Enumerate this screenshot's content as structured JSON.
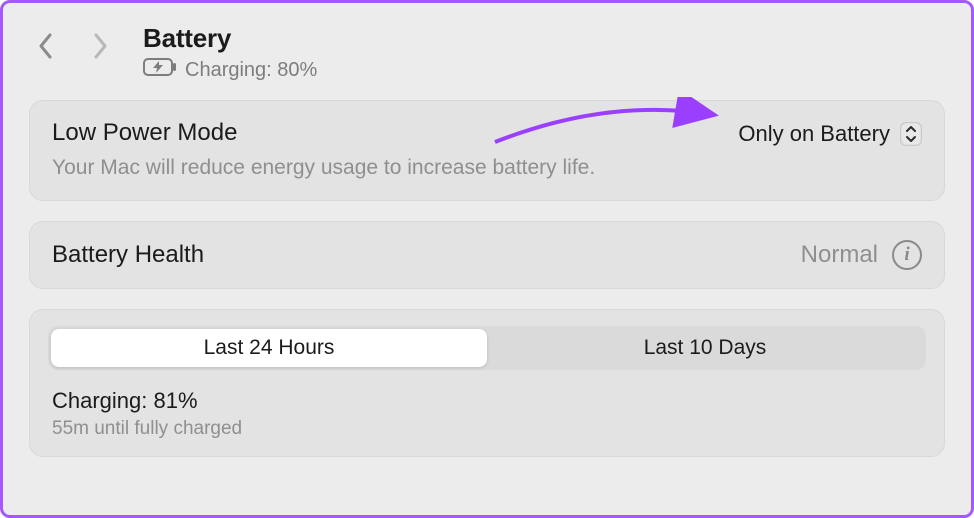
{
  "header": {
    "title": "Battery",
    "status": "Charging: 80%"
  },
  "lowPowerMode": {
    "label": "Low Power Mode",
    "description": "Your Mac will reduce energy usage to increase battery life.",
    "selected": "Only on Battery"
  },
  "batteryHealth": {
    "label": "Battery Health",
    "status": "Normal"
  },
  "usage": {
    "tabs": {
      "first": "Last 24 Hours",
      "second": "Last 10 Days"
    },
    "chargingLine": "Charging: 81%",
    "etaLine": "55m until fully charged"
  }
}
